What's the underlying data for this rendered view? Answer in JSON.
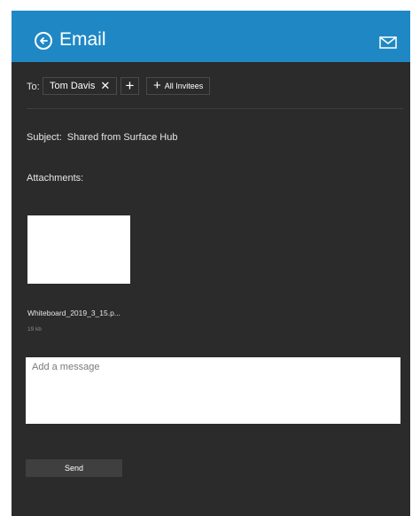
{
  "header": {
    "title": "Email",
    "back_icon": "arrow-left-circle-icon",
    "mail_icon": "envelope-icon",
    "accent_color": "#1f88c4"
  },
  "to": {
    "label": "To:",
    "recipients": [
      {
        "name": "Tom Davis",
        "remove_icon": "close-icon"
      }
    ],
    "add_icon": "plus-icon",
    "all_invitees_label": "All Invitees"
  },
  "subject": {
    "label": "Subject:",
    "value": "Shared from Surface Hub"
  },
  "attachments": {
    "label": "Attachments:",
    "items": [
      {
        "file_name": "Whiteboard_2019_3_15.p...",
        "size": "19 kb"
      }
    ]
  },
  "message": {
    "placeholder": "Add a message",
    "value": ""
  },
  "send_label": "Send",
  "background_color": "#2b2b2b"
}
